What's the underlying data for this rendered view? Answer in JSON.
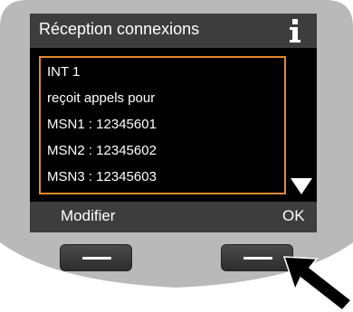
{
  "screen": {
    "title": "Réception connexions",
    "title_icon": "info-icon",
    "lines": [
      "INT 1",
      "reçoit appels pour",
      "MSN1 : 12345601",
      "MSN2 : 12345602",
      "MSN3 : 12345603"
    ],
    "scroll_icon": "triangle-down-icon"
  },
  "softkeys": {
    "left_label": "Modifier",
    "right_label": "OK"
  },
  "colors": {
    "bezel": "#b8b9b8",
    "title_bar": "#3c3d3c",
    "list_border": "#e3892c"
  }
}
